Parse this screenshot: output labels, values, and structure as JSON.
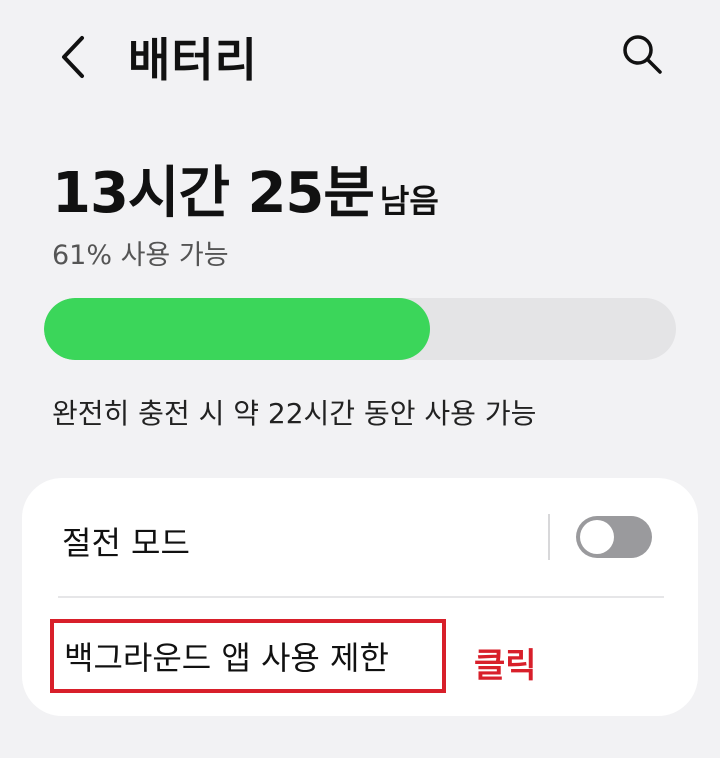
{
  "header": {
    "title": "배터리",
    "back_icon": "chevron-left-icon",
    "search_icon": "search-icon"
  },
  "battery": {
    "time_remaining": "13시간 25분",
    "remaining_suffix": "남음",
    "percent_text": "61% 사용 가능",
    "level_fraction": 0.61,
    "level_color": "#3bd65a",
    "full_charge_text": "완전히 충전 시 약 22시간 동안 사용 가능"
  },
  "settings": {
    "power_saving_label": "절전 모드",
    "power_saving_on": false,
    "background_limit_label": "백그라운드 앱 사용 제한"
  },
  "annotation": {
    "text": "클릭",
    "color": "#d81f2a"
  }
}
